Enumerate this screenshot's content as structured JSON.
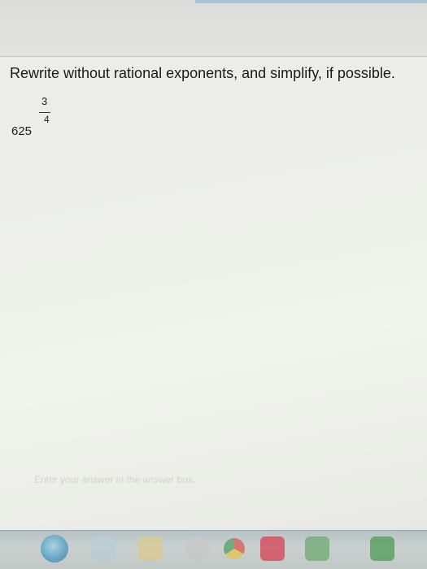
{
  "question": {
    "instruction": "Rewrite without rational exponents, and simplify, if possible.",
    "base": "625",
    "exponent_numerator": "3",
    "exponent_denominator": "4"
  },
  "answer_input": {
    "placeholder": "Enter your answer in the answer box."
  },
  "taskbar": {
    "icons": [
      "start-orb",
      "internet-explorer-icon",
      "file-explorer-icon",
      "media-player-icon",
      "chrome-icon",
      "red-app-icon",
      "green-app-icon",
      "excel-icon"
    ]
  },
  "colors": {
    "page_background": "#ececea",
    "text": "#1a1a1a",
    "accent": "#a9c4d8",
    "taskbar": "#c1c9c6"
  }
}
